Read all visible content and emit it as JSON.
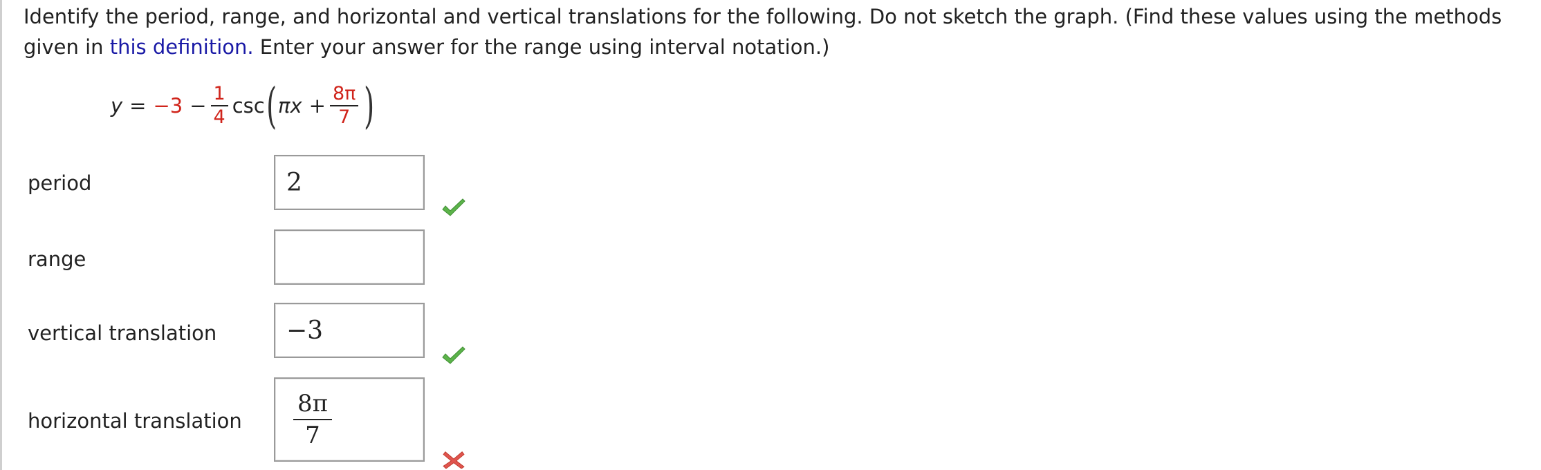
{
  "instructions": {
    "text_before_link": "Identify the period, range, and horizontal and vertical translations for the following. Do not sketch the graph. (Find these values using the methods given in ",
    "link_text": "this definition.",
    "text_after_link": " Enter your answer for the range using interval notation.)"
  },
  "equation": {
    "lhs": "y",
    "equals": "=",
    "vertical_shift": "−3",
    "minus": "−",
    "coef_numerator": "1",
    "coef_denominator": "4",
    "function": "csc",
    "argument_var": "πx",
    "plus": "+",
    "shift_numerator": "8π",
    "shift_denominator": "7"
  },
  "rows": {
    "period": {
      "label": "period",
      "value": "2",
      "status": "correct"
    },
    "range": {
      "label": "range",
      "value": "",
      "status": "none"
    },
    "vertical_translation": {
      "label": "vertical translation",
      "value": "−3",
      "status": "correct"
    },
    "horizontal_translation": {
      "label": "horizontal translation",
      "value_numerator": "8π",
      "value_denominator": "7",
      "status": "incorrect"
    }
  },
  "colors": {
    "text": "#222222",
    "link": "#1a1aa6",
    "equation_highlight": "#d0241b",
    "check": "#5cb34a",
    "cross": "#e0554f",
    "box_border": "#9a9a9a"
  },
  "icons": {
    "correct": "check-icon",
    "incorrect": "cross-icon"
  }
}
